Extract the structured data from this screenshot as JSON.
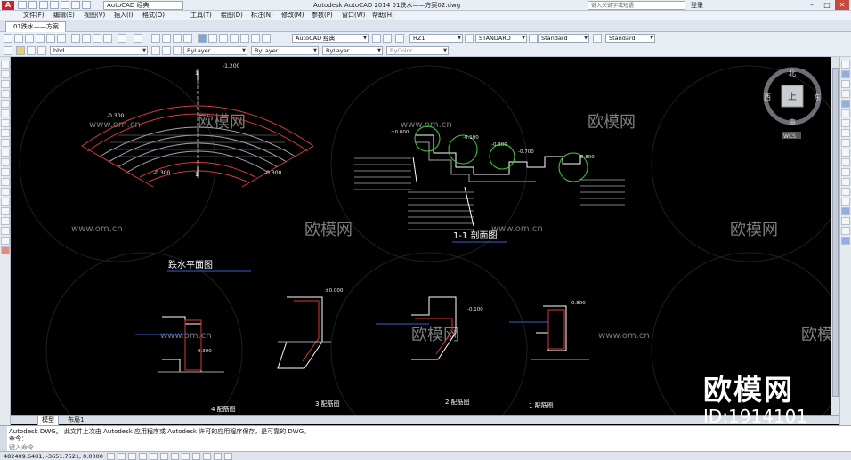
{
  "titlebar": {
    "app_icon": "A",
    "workspace": "AutoCAD 经典",
    "title": "Autodesk AutoCAD 2014    01跌水——方案02.dwg",
    "search_placeholder": "键入关键字或短语",
    "login": "登录",
    "min": "–",
    "max": "□",
    "close": "✕"
  },
  "menubar": {
    "items": [
      "文件(F)",
      "编辑(E)",
      "视图(V)",
      "插入(I)",
      "格式(O)",
      "工具(T)",
      "绘图(D)",
      "标注(N)",
      "修改(M)",
      "参数(P)",
      "窗口(W)",
      "帮助(H)"
    ]
  },
  "tabstrip": {
    "active_tab": "01跌水——方案02"
  },
  "toolbar1": {
    "workspace_combo": "AutoCAD 经典",
    "text_style": "HZ1",
    "dim_style": "STANDARD",
    "table_style": "Standard",
    "mleader_style": "Standard"
  },
  "toolbar2": {
    "layer": "hhd",
    "color": "ByLayer",
    "linetype": "ByLayer",
    "lineweight": "ByLayer",
    "plotstyle": "ByColor"
  },
  "viewcube": {
    "north": "北",
    "south": "南",
    "east": "东",
    "west": "西",
    "face": "上",
    "wcs": "WCS"
  },
  "drawing": {
    "plan_title": "跌水平面图",
    "section_title": "1-1  剖面图",
    "detail_titles": [
      "4  配筋图",
      "3  配筋图",
      "2  配筋图",
      "1  配筋图"
    ],
    "elevations": [
      "-1.200",
      "-0.300",
      "-0.300",
      "-0.300",
      "±0.000",
      "-0.100",
      "-0.300",
      "-0.700",
      "-0.800",
      "-0.800"
    ],
    "section_mark": "1",
    "watermark_url": "www.om.cn",
    "watermark_brand": "欧模网"
  },
  "layouttabs": {
    "model": "模型",
    "layout1": "布局1"
  },
  "cmdwin": {
    "line1": "Autodesk DWG。   此文件上次由 Autodesk 应用程序或 Autodesk 许可的应用程序保存，是可靠的 DWG。",
    "line2": "命令：",
    "prompt": "键入命令"
  },
  "statusbar": {
    "coords": "482409.6481,  -3651.7521,  0.0000"
  },
  "bigmark": {
    "brand": "欧模网",
    "id": "ID:1914101"
  }
}
